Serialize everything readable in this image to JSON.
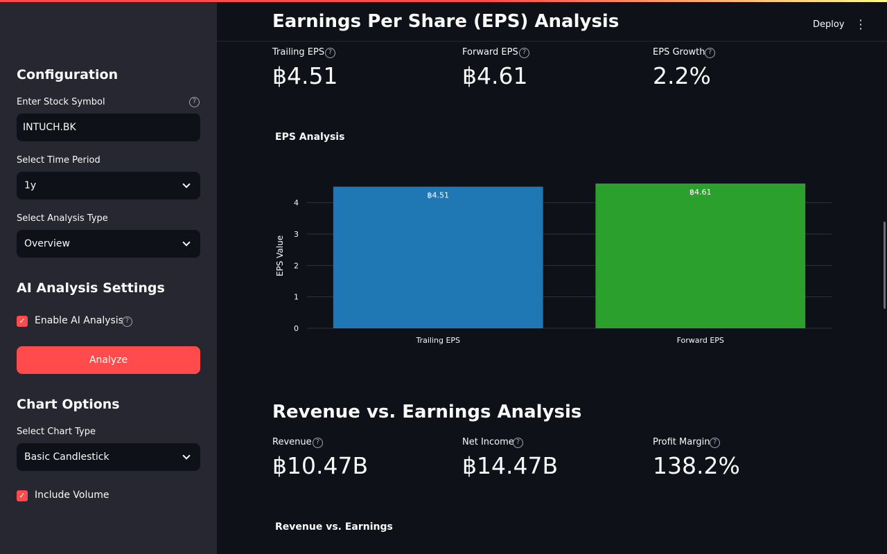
{
  "sidebar": {
    "configuration_heading": "Configuration",
    "stock_symbol": {
      "label": "Enter Stock Symbol",
      "value": "INTUCH.BK"
    },
    "time_period": {
      "label": "Select Time Period",
      "value": "1y"
    },
    "analysis_type": {
      "label": "Select Analysis Type",
      "value": "Overview"
    },
    "ai_heading": "AI Analysis Settings",
    "enable_ai": {
      "label": "Enable AI Analysis",
      "checked": true
    },
    "analyze_button": "Analyze",
    "chart_options_heading": "Chart Options",
    "chart_type": {
      "label": "Select Chart Type",
      "value": "Basic Candlestick"
    },
    "include_volume": {
      "label": "Include Volume",
      "checked": true
    }
  },
  "header": {
    "title": "Earnings Per Share (EPS) Analysis",
    "deploy": "Deploy",
    "menu_icon": "kebab-menu-icon"
  },
  "eps_metrics": [
    {
      "label": "Trailing EPS",
      "value": "฿4.51"
    },
    {
      "label": "Forward EPS",
      "value": "฿4.61"
    },
    {
      "label": "EPS Growth",
      "value": "2.2%"
    }
  ],
  "eps_chart_title": "EPS Analysis",
  "revenue_section_title": "Revenue vs. Earnings Analysis",
  "revenue_metrics": [
    {
      "label": "Revenue",
      "value": "฿10.47B"
    },
    {
      "label": "Net Income",
      "value": "฿14.47B"
    },
    {
      "label": "Profit Margin",
      "value": "138.2%"
    }
  ],
  "revenue_chart_title": "Revenue vs. Earnings",
  "colors": {
    "accent": "#ff4b4b",
    "trailing": "#1f77b4",
    "forward": "#2ca02c"
  },
  "chart_data": {
    "type": "bar",
    "title": "EPS Analysis",
    "categories": [
      "Trailing EPS",
      "Forward EPS"
    ],
    "values": [
      4.51,
      4.61
    ],
    "data_labels": [
      "฿4.51",
      "฿4.61"
    ],
    "ylabel": "EPS Value",
    "xlabel": "",
    "ylim": [
      0,
      4.61
    ],
    "yticks": [
      0,
      1,
      2,
      3,
      4
    ],
    "bar_colors": [
      "#1f77b4",
      "#2ca02c"
    ],
    "grid": true
  }
}
